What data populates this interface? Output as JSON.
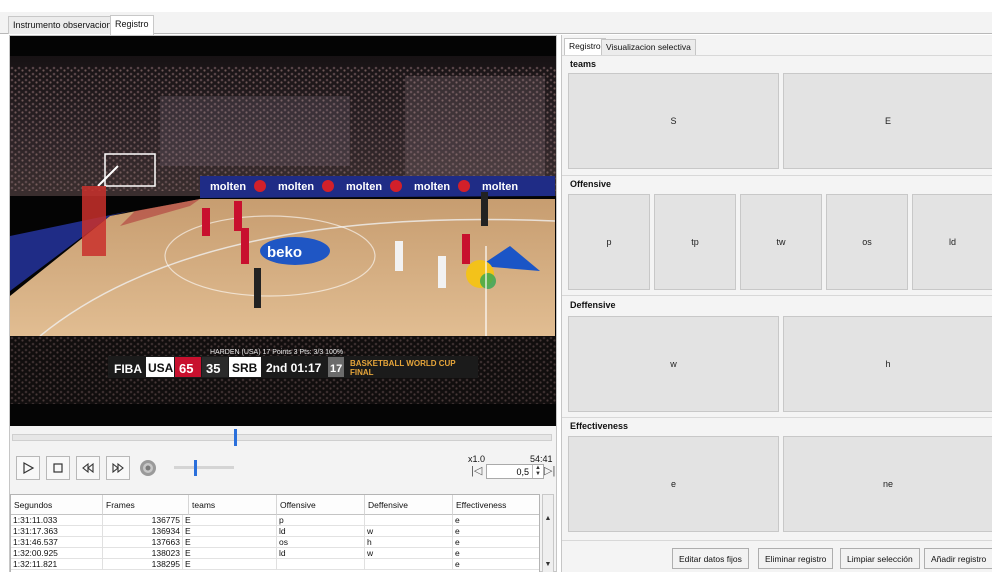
{
  "main_tabs": [
    {
      "label": "Instrumento observacional"
    },
    {
      "label": "Registro"
    }
  ],
  "video": {
    "ad_text": "molten",
    "court_text": "beko",
    "scoreboard": {
      "league": "FIBA",
      "team_a": "USA",
      "score_a": "65",
      "score_b": "35",
      "team_b": "SRB",
      "period_clock": "2nd 01:17",
      "shot_clock": "17",
      "event_line1": "BASKETBALL WORLD CUP",
      "event_line2": "FINAL",
      "player_info": "HARDEN (USA)   17 Points   3 Pts: 3/3 100%"
    },
    "seek_fraction": 0.41
  },
  "controls": {
    "volume_fraction": 0.35,
    "speed_label": "x1.0",
    "time_label": "54:41",
    "speed_value": "0,5"
  },
  "table": {
    "columns": [
      "Segundos",
      "Frames",
      "teams",
      "Offensive",
      "Deffensive",
      "Effectiveness"
    ],
    "rows": [
      [
        "1:31:11.033",
        "136775",
        "E",
        "p",
        "",
        "e"
      ],
      [
        "1:31:17.363",
        "136934",
        "E",
        "ld",
        "w",
        "e"
      ],
      [
        "1:31:46.537",
        "137663",
        "E",
        "os",
        "h",
        "e"
      ],
      [
        "1:32:00.925",
        "138023",
        "E",
        "ld",
        "w",
        "e"
      ],
      [
        "1:32:11.821",
        "138295",
        "E",
        "",
        "",
        "e"
      ]
    ]
  },
  "right_tabs": [
    {
      "label": "Registro"
    },
    {
      "label": "Visualizacion selectiva"
    }
  ],
  "groups": {
    "teams": {
      "title": "teams",
      "items": [
        "S",
        "E"
      ]
    },
    "offensive": {
      "title": "Offensive",
      "items": [
        "p",
        "tp",
        "tw",
        "os",
        "ld"
      ]
    },
    "deffensive": {
      "title": "Deffensive",
      "items": [
        "w",
        "h"
      ]
    },
    "effectiveness": {
      "title": "Effectiveness",
      "items": [
        "e",
        "ne"
      ]
    }
  },
  "footer": {
    "edit_label": "Editar datos fijos",
    "delete_label": "Eliminar registro",
    "clear_label": "Limpiar selección",
    "add_label": "Añadir registro"
  },
  "colors": {
    "accent": "#2a6fdb",
    "scoreboard_red": "#c8102e",
    "court": "#d8b184"
  }
}
